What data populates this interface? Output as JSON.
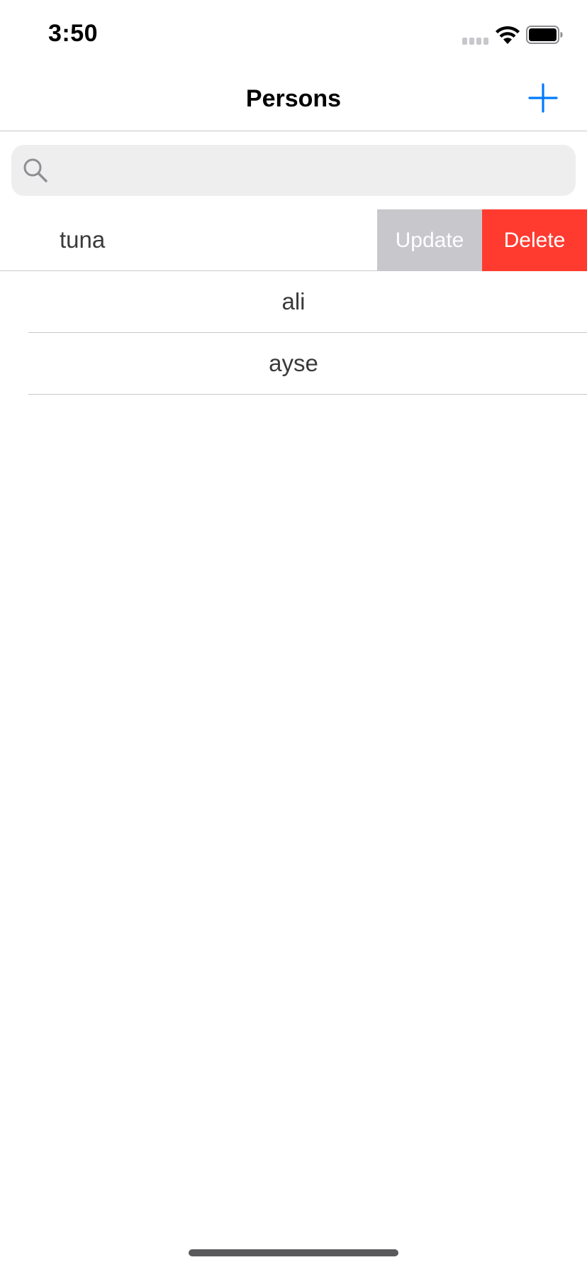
{
  "status_bar": {
    "time": "3:50",
    "icons": [
      "signal-icon",
      "wifi-icon",
      "battery-icon"
    ]
  },
  "nav": {
    "title": "Persons",
    "add_icon": "plus-icon",
    "accent_color": "#007aff"
  },
  "search": {
    "placeholder": "",
    "value": "",
    "icon": "search-icon"
  },
  "list": {
    "rows": [
      {
        "name": "tuna",
        "swiped": true,
        "actions": [
          {
            "label": "Update",
            "color": "#c7c7cc"
          },
          {
            "label": "Delete",
            "color": "#ff3b30"
          }
        ]
      },
      {
        "name": "ali",
        "swiped": false
      },
      {
        "name": "ayse",
        "swiped": false
      }
    ]
  }
}
